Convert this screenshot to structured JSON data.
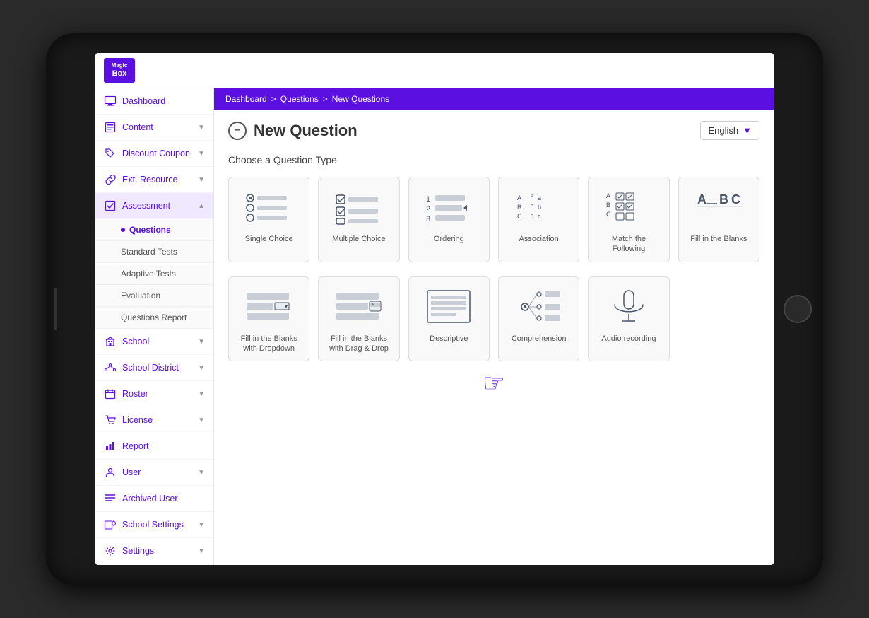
{
  "tablet": {
    "top_bar": {
      "logo_line1": "Magic",
      "logo_line2": "Box"
    },
    "breadcrumb": {
      "items": [
        "Dashboard",
        ">",
        "Questions",
        ">",
        "New Questions"
      ]
    },
    "sidebar": {
      "items": [
        {
          "id": "dashboard",
          "label": "Dashboard",
          "icon": "monitor",
          "has_arrow": false
        },
        {
          "id": "content",
          "label": "Content",
          "icon": "content",
          "has_arrow": true
        },
        {
          "id": "discount",
          "label": "Discount Coupon",
          "icon": "tag",
          "has_arrow": true
        },
        {
          "id": "ext-resource",
          "label": "Ext. Resource",
          "icon": "link",
          "has_arrow": true
        },
        {
          "id": "assessment",
          "label": "Assessment",
          "icon": "check",
          "has_arrow": true,
          "expanded": true
        }
      ],
      "submenu": [
        {
          "id": "questions",
          "label": "Questions",
          "active": true
        },
        {
          "id": "standard-tests",
          "label": "Standard Tests"
        },
        {
          "id": "adaptive-tests",
          "label": "Adaptive Tests"
        },
        {
          "id": "evaluation",
          "label": "Evaluation"
        },
        {
          "id": "questions-report",
          "label": "Questions Report"
        }
      ],
      "items2": [
        {
          "id": "school",
          "label": "School",
          "icon": "building",
          "has_arrow": true
        },
        {
          "id": "school-district",
          "label": "School District",
          "icon": "district",
          "has_arrow": true
        },
        {
          "id": "roster",
          "label": "Roster",
          "icon": "calendar",
          "has_arrow": true
        },
        {
          "id": "license",
          "label": "License",
          "icon": "cart",
          "has_arrow": true
        },
        {
          "id": "report",
          "label": "Report",
          "icon": "chart",
          "has_arrow": false
        },
        {
          "id": "user",
          "label": "User",
          "icon": "user",
          "has_arrow": true
        },
        {
          "id": "archived-user",
          "label": "Archived User",
          "icon": "lines",
          "has_arrow": false
        },
        {
          "id": "school-settings",
          "label": "School Settings",
          "icon": "gear-school",
          "has_arrow": true
        },
        {
          "id": "settings",
          "label": "Settings",
          "icon": "gear",
          "has_arrow": true
        }
      ]
    },
    "main": {
      "page_title": "New Question",
      "language": {
        "selected": "English",
        "arrow": "▼"
      },
      "section_label": "Choose a Question Type",
      "question_types": [
        {
          "id": "single-choice",
          "label": "Single Choice"
        },
        {
          "id": "multiple-choice",
          "label": "Multiple Choice"
        },
        {
          "id": "ordering",
          "label": "Ordering"
        },
        {
          "id": "association",
          "label": "Association"
        },
        {
          "id": "match-following",
          "label": "Match the Following"
        },
        {
          "id": "fill-blanks",
          "label": "Fill in the Blanks"
        },
        {
          "id": "fill-blanks-dropdown",
          "label": "Fill in the Blanks with Dropdown"
        },
        {
          "id": "fill-blanks-drag",
          "label": "Fill in the Blanks with Drag & Drop"
        },
        {
          "id": "descriptive",
          "label": "Descriptive"
        },
        {
          "id": "comprehension",
          "label": "Comprehension"
        },
        {
          "id": "audio-recording",
          "label": "Audio recording"
        }
      ]
    }
  }
}
